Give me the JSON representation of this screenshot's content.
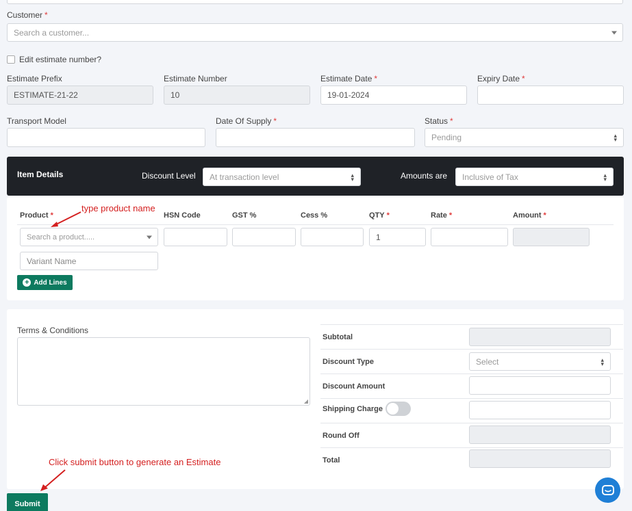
{
  "customer": {
    "label": "Customer",
    "placeholder": "Search a customer..."
  },
  "edit_estimate": {
    "label": "Edit estimate number?"
  },
  "estimate_prefix": {
    "label": "Estimate Prefix",
    "value": "ESTIMATE-21-22"
  },
  "estimate_number": {
    "label": "Estimate Number",
    "value": "10"
  },
  "estimate_date": {
    "label": "Estimate Date",
    "value": "19-01-2024"
  },
  "expiry_date": {
    "label": "Expiry Date",
    "value": ""
  },
  "transport_model": {
    "label": "Transport Model",
    "value": ""
  },
  "date_of_supply": {
    "label": "Date Of Supply",
    "value": ""
  },
  "status": {
    "label": "Status",
    "value": "Pending"
  },
  "item_details": {
    "title": "Item Details",
    "discount_level_label": "Discount Level",
    "discount_level_value": "At transaction level",
    "amounts_label": "Amounts are",
    "amounts_value": "Inclusive of Tax"
  },
  "items_table": {
    "headers": {
      "product": "Product",
      "hsn": "HSN Code",
      "gst": "GST %",
      "cess": "Cess %",
      "qty": "QTY",
      "rate": "Rate",
      "amount": "Amount"
    },
    "product_placeholder": "Search a product.....",
    "qty_value": "1",
    "variant_placeholder": "Variant Name",
    "add_lines_label": "Add Lines"
  },
  "terms": {
    "label": "Terms & Conditions"
  },
  "summary": {
    "subtotal": "Subtotal",
    "discount_type": "Discount Type",
    "discount_type_placeholder": "Select",
    "discount_amount": "Discount Amount",
    "shipping_charge": "Shipping Charge",
    "round_off": "Round Off",
    "total": "Total"
  },
  "submit_label": "Submit",
  "annotations": {
    "product_hint": "type product name",
    "submit_hint": "Click submit button to generate an Estimate"
  },
  "colors": {
    "accent_green": "#0d7a5f",
    "dark_header": "#1f2227",
    "required": "#e03b3b",
    "annotation": "#d42020",
    "chat_blue": "#1f7fd6"
  }
}
